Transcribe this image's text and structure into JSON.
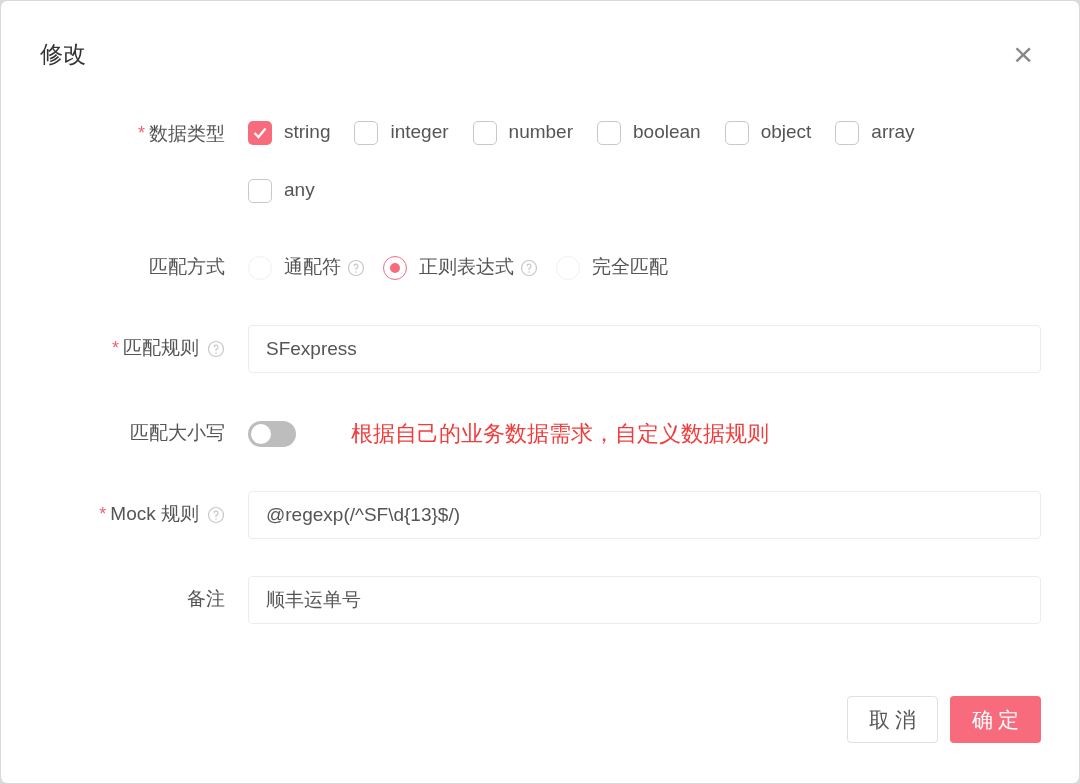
{
  "dialog": {
    "title": "修改",
    "close": "×"
  },
  "fields": [
    {
      "kind": "checkboxes",
      "label": "数据类型",
      "required_mark": "*",
      "help": false,
      "options": [
        {
          "label": "string",
          "checked": true
        },
        {
          "label": "integer",
          "checked": false
        },
        {
          "label": "number",
          "checked": false
        },
        {
          "label": "boolean",
          "checked": false
        },
        {
          "label": "object",
          "checked": false
        },
        {
          "label": "array",
          "checked": false
        },
        {
          "label": "any",
          "checked": false
        }
      ]
    },
    {
      "kind": "radios",
      "label": "匹配方式",
      "help": false,
      "options": [
        {
          "label": "通配符",
          "selected": false,
          "help": true
        },
        {
          "label": "正则表达式",
          "selected": true,
          "help": true
        },
        {
          "label": "完全匹配",
          "selected": false,
          "help": false
        }
      ]
    },
    {
      "kind": "input",
      "label": "匹配规则",
      "required_mark": "*",
      "help": true,
      "value": "SFexpress"
    },
    {
      "kind": "switch",
      "label": "匹配大小写",
      "help": false,
      "on": false,
      "note": "根据自己的业务数据需求，自定义数据规则"
    },
    {
      "kind": "input",
      "label": "Mock 规则",
      "required_mark": "*",
      "help": true,
      "value": "@regexp(/^SF\\d{13}$/)"
    },
    {
      "kind": "input",
      "label": "备注",
      "help": false,
      "value": "顺丰运单号"
    }
  ],
  "buttons": [
    {
      "label": "取 消",
      "kind": "secondary"
    },
    {
      "label": "确 定",
      "kind": "primary"
    }
  ]
}
